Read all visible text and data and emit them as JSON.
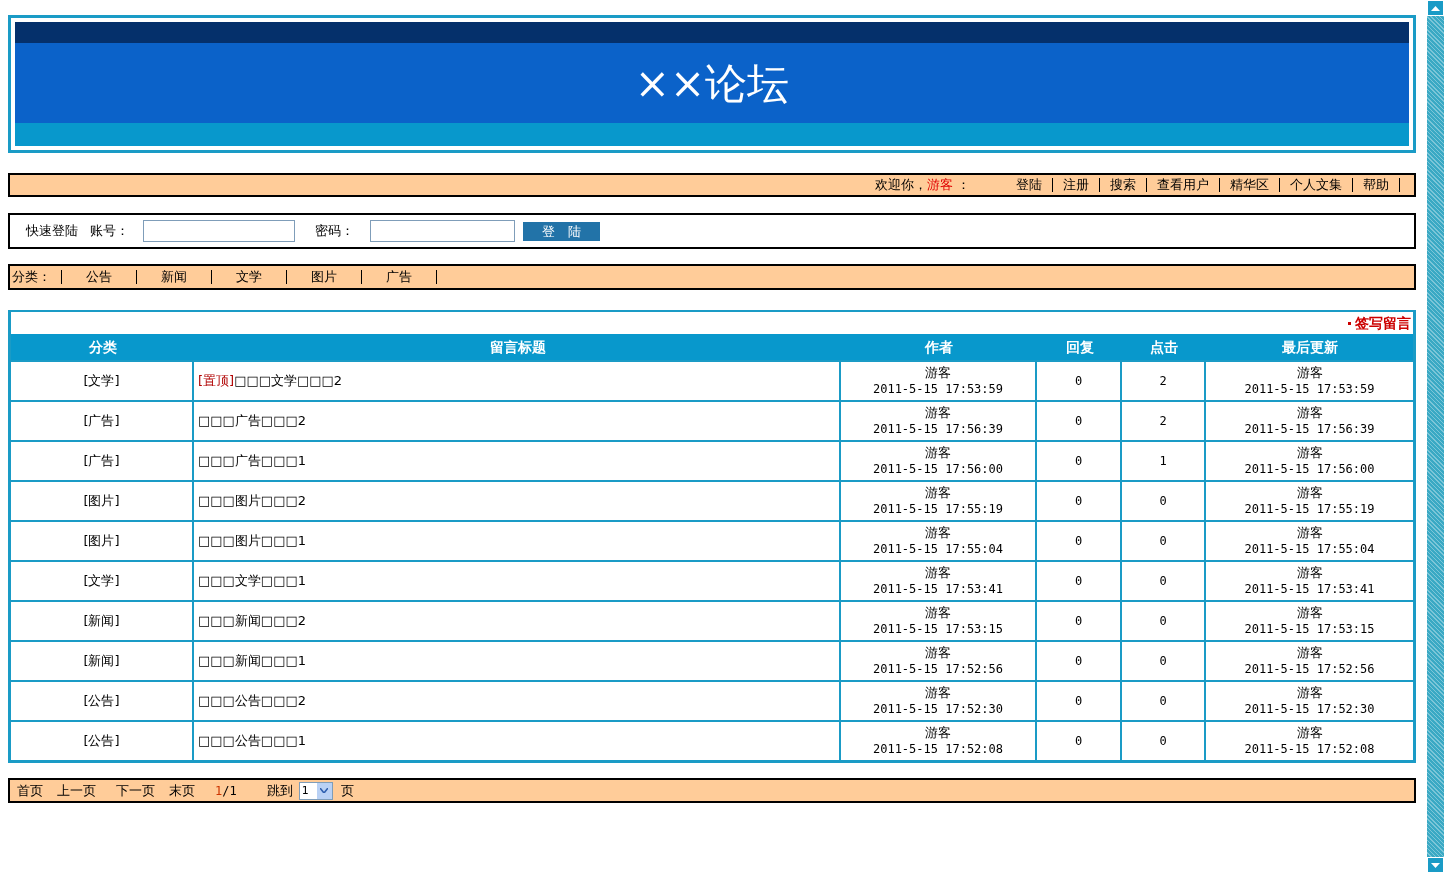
{
  "header": {
    "title": "××论坛"
  },
  "user_bar": {
    "greeting": "欢迎你，",
    "username": "游客",
    "colon": "：",
    "links": [
      "登陆",
      "注册",
      "搜索",
      "查看用户",
      "精华区",
      "个人文集",
      "帮助"
    ]
  },
  "quick_login": {
    "label": "快速登陆",
    "account_label": "账号：",
    "password_label": "密码：",
    "button": "登　陆"
  },
  "categories": {
    "label": "分类：",
    "items": [
      "公告",
      "新闻",
      "文学",
      "图片",
      "广告"
    ]
  },
  "board": {
    "post_link": "签写留言",
    "columns": [
      "分类",
      "留言标题",
      "作者",
      "回复",
      "点击",
      "最后更新"
    ],
    "rows": [
      {
        "category": "[文学]",
        "pin_label": "[置顶]",
        "title": "□□□文学□□□2",
        "author": "游客",
        "posted": "2011-5-15 17:53:59",
        "replies": "0",
        "clicks": "2",
        "last_user": "游客",
        "last_time": "2011-5-15 17:53:59"
      },
      {
        "category": "[广告]",
        "title": "□□□广告□□□2",
        "author": "游客",
        "posted": "2011-5-15 17:56:39",
        "replies": "0",
        "clicks": "2",
        "last_user": "游客",
        "last_time": "2011-5-15 17:56:39"
      },
      {
        "category": "[广告]",
        "title": "□□□广告□□□1",
        "author": "游客",
        "posted": "2011-5-15 17:56:00",
        "replies": "0",
        "clicks": "1",
        "last_user": "游客",
        "last_time": "2011-5-15 17:56:00"
      },
      {
        "category": "[图片]",
        "title": "□□□图片□□□2",
        "author": "游客",
        "posted": "2011-5-15 17:55:19",
        "replies": "0",
        "clicks": "0",
        "last_user": "游客",
        "last_time": "2011-5-15 17:55:19"
      },
      {
        "category": "[图片]",
        "title": "□□□图片□□□1",
        "author": "游客",
        "posted": "2011-5-15 17:55:04",
        "replies": "0",
        "clicks": "0",
        "last_user": "游客",
        "last_time": "2011-5-15 17:55:04"
      },
      {
        "category": "[文学]",
        "title": "□□□文学□□□1",
        "author": "游客",
        "posted": "2011-5-15 17:53:41",
        "replies": "0",
        "clicks": "0",
        "last_user": "游客",
        "last_time": "2011-5-15 17:53:41"
      },
      {
        "category": "[新闻]",
        "title": "□□□新闻□□□2",
        "author": "游客",
        "posted": "2011-5-15 17:53:15",
        "replies": "0",
        "clicks": "0",
        "last_user": "游客",
        "last_time": "2011-5-15 17:53:15"
      },
      {
        "category": "[新闻]",
        "title": "□□□新闻□□□1",
        "author": "游客",
        "posted": "2011-5-15 17:52:56",
        "replies": "0",
        "clicks": "0",
        "last_user": "游客",
        "last_time": "2011-5-15 17:52:56"
      },
      {
        "category": "[公告]",
        "title": "□□□公告□□□2",
        "author": "游客",
        "posted": "2011-5-15 17:52:30",
        "replies": "0",
        "clicks": "0",
        "last_user": "游客",
        "last_time": "2011-5-15 17:52:30"
      },
      {
        "category": "[公告]",
        "title": "□□□公告□□□1",
        "author": "游客",
        "posted": "2011-5-15 17:52:08",
        "replies": "0",
        "clicks": "0",
        "last_user": "游客",
        "last_time": "2011-5-15 17:52:08"
      }
    ]
  },
  "pagination": {
    "links": [
      "首页",
      "上一页",
      "下一页",
      "末页"
    ],
    "current": "1",
    "total": "/1",
    "jump_label": "跳到",
    "page_select": "1",
    "page_unit": "页"
  }
}
